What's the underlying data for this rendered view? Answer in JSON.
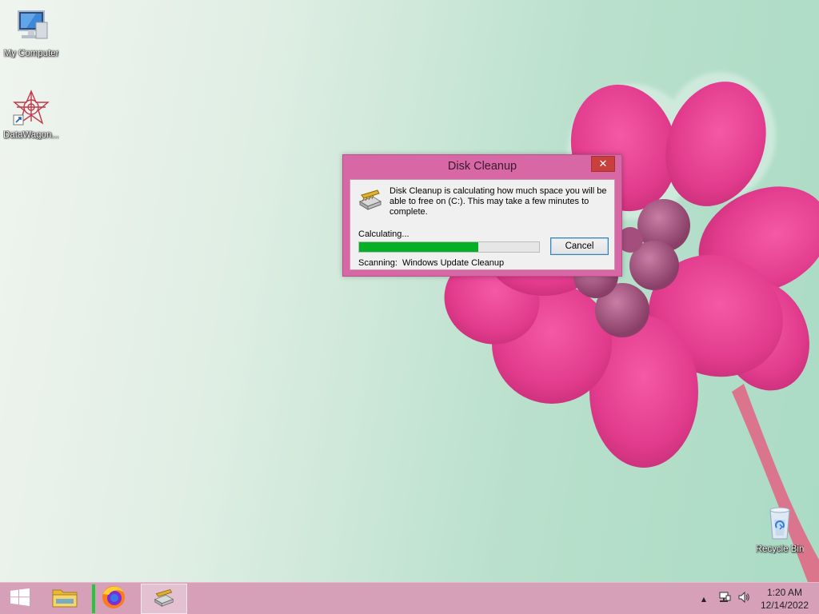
{
  "desktop": {
    "icons": [
      {
        "label": "My Computer",
        "icon": "computer-icon"
      },
      {
        "label": "DataWagon...",
        "icon": "datawagon-icon"
      },
      {
        "label": "Recycle Bin",
        "icon": "recycle-bin-icon"
      }
    ]
  },
  "dialog": {
    "title": "Disk Cleanup",
    "close_symbol": "✕",
    "message": "Disk Cleanup is calculating how much space you will be able to free on  (C:). This may take a few minutes to complete.",
    "status_label": "Calculating...",
    "progress": 0.66,
    "cancel_label": "Cancel",
    "scanning_label": "Scanning:",
    "scanning_item": "Windows Update Cleanup",
    "accent_color": "#d767a5",
    "progress_color": "#06b025"
  },
  "taskbar": {
    "items": [
      {
        "name": "start",
        "icon": "windows-logo-icon"
      },
      {
        "name": "file-explorer",
        "icon": "folder-icon"
      },
      {
        "name": "firefox",
        "icon": "firefox-icon",
        "running": true
      },
      {
        "name": "disk-cleanup",
        "icon": "disk-cleanup-icon",
        "active": true
      }
    ],
    "tray": {
      "overflow_symbol": "▲",
      "time": "1:20 AM",
      "date": "12/14/2022"
    }
  }
}
